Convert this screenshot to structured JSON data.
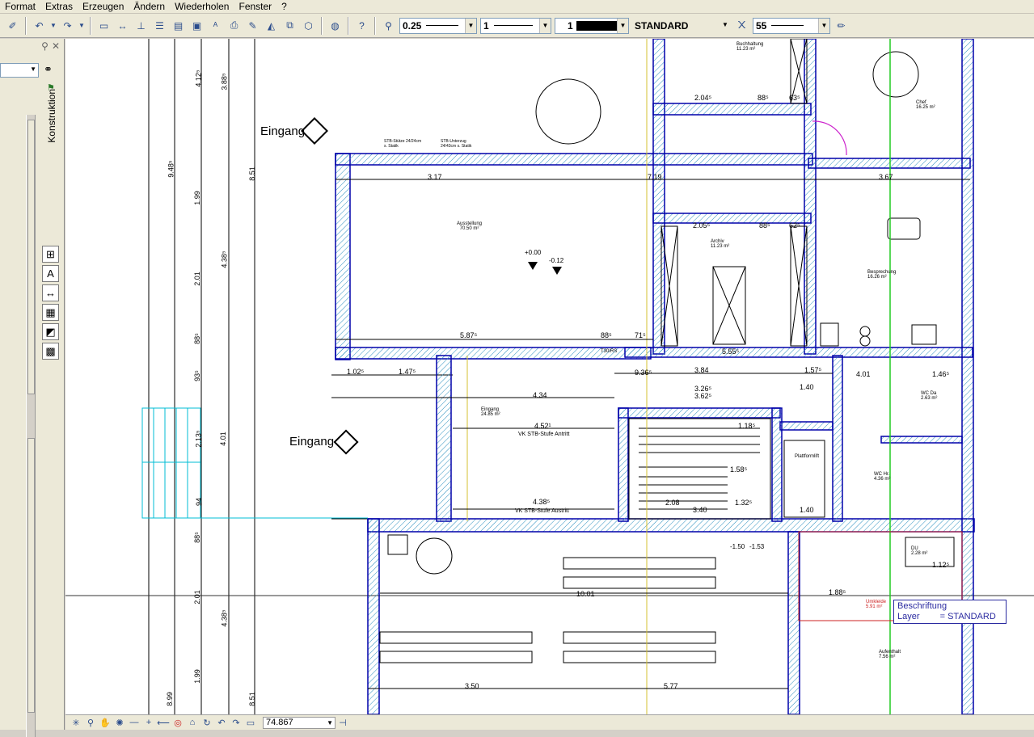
{
  "menu": {
    "items": [
      "Format",
      "Extras",
      "Erzeugen",
      "Ändern",
      "Wiederholen",
      "Fenster",
      "?"
    ]
  },
  "toolbar": {
    "pen_thickness": "0.25",
    "line_type": "1",
    "color_number": "1",
    "layer": "STANDARD",
    "scale": "55"
  },
  "sidebar": {
    "tab_label": "Konstruktion"
  },
  "status": {
    "zoom_value": "74.867"
  },
  "tooltip": {
    "line1_label": "Beschriftung",
    "line2_label": "Layer",
    "line2_value": "= STANDARD"
  },
  "plan": {
    "entrance_label": "Eingang",
    "rooms": [
      {
        "name": "Ausstellung",
        "area": "70.50 m²"
      },
      {
        "name": "Archiv",
        "area": "11.23 m²"
      },
      {
        "name": "Besprechung",
        "area": "16.26 m²"
      },
      {
        "name": "Chef",
        "area": "16.25 m²"
      },
      {
        "name": "Buchhaltung",
        "area": "11.23 m²"
      },
      {
        "name": "Eingang",
        "area": "24.85 m²"
      },
      {
        "name": "WC Da",
        "area": "2.63 m²"
      },
      {
        "name": "WC Hr.",
        "area": "4.36 m²"
      },
      {
        "name": "Aufenthalt",
        "area": "7.56 m²"
      },
      {
        "name": "DU",
        "area": "2.28 m²"
      },
      {
        "name": "Umkleide",
        "area": "5.91 m²"
      },
      {
        "name": "Plattformlift",
        "area": ""
      }
    ],
    "dims_top": [
      "3.17",
      "7.19",
      "3.67",
      "5.87⁵",
      "88⁵",
      "71⁵",
      "5.55⁵",
      "2.05⁵",
      "88⁵",
      "62⁵",
      "2.04⁵",
      "88⁵",
      "63⁵"
    ],
    "dims_left_a": [
      "4.12⁵",
      "9.48⁵",
      "1.99",
      "2.01",
      "88⁵",
      "93⁵",
      "2.13⁵",
      "94",
      "88⁵",
      "2.01",
      "1.99",
      "8.99"
    ],
    "dims_left_b": [
      "3.88⁵",
      "8.51",
      "4.38⁵",
      "4.01",
      "4.38⁵",
      "8.51"
    ],
    "dims_mid": [
      "1.02⁵",
      "1.47⁵",
      "4.34",
      "4.52¹",
      "4.38⁵",
      "9.36⁵",
      "3.84",
      "1.57⁵",
      "1.40",
      "1.40",
      "3.26⁵",
      "3.62⁵",
      "1.18⁵",
      "1.58⁵",
      "1.32⁵",
      "3.40",
      "2.08",
      "10.01",
      "3.50",
      "5.77",
      "1.88⁵",
      "1.12⁵",
      "1.46⁵",
      "4.01"
    ],
    "notes": [
      "VK STB-Stufe Antritt",
      "VK STB-Stufe Austritt",
      "T30/RS",
      "STB-Stütze 24/24cm s. Statik",
      "STB-Unterzug 24/43cm s. Statik"
    ],
    "levels": [
      "+0.00",
      "-0.12",
      "-1.50",
      "-1.53"
    ]
  }
}
